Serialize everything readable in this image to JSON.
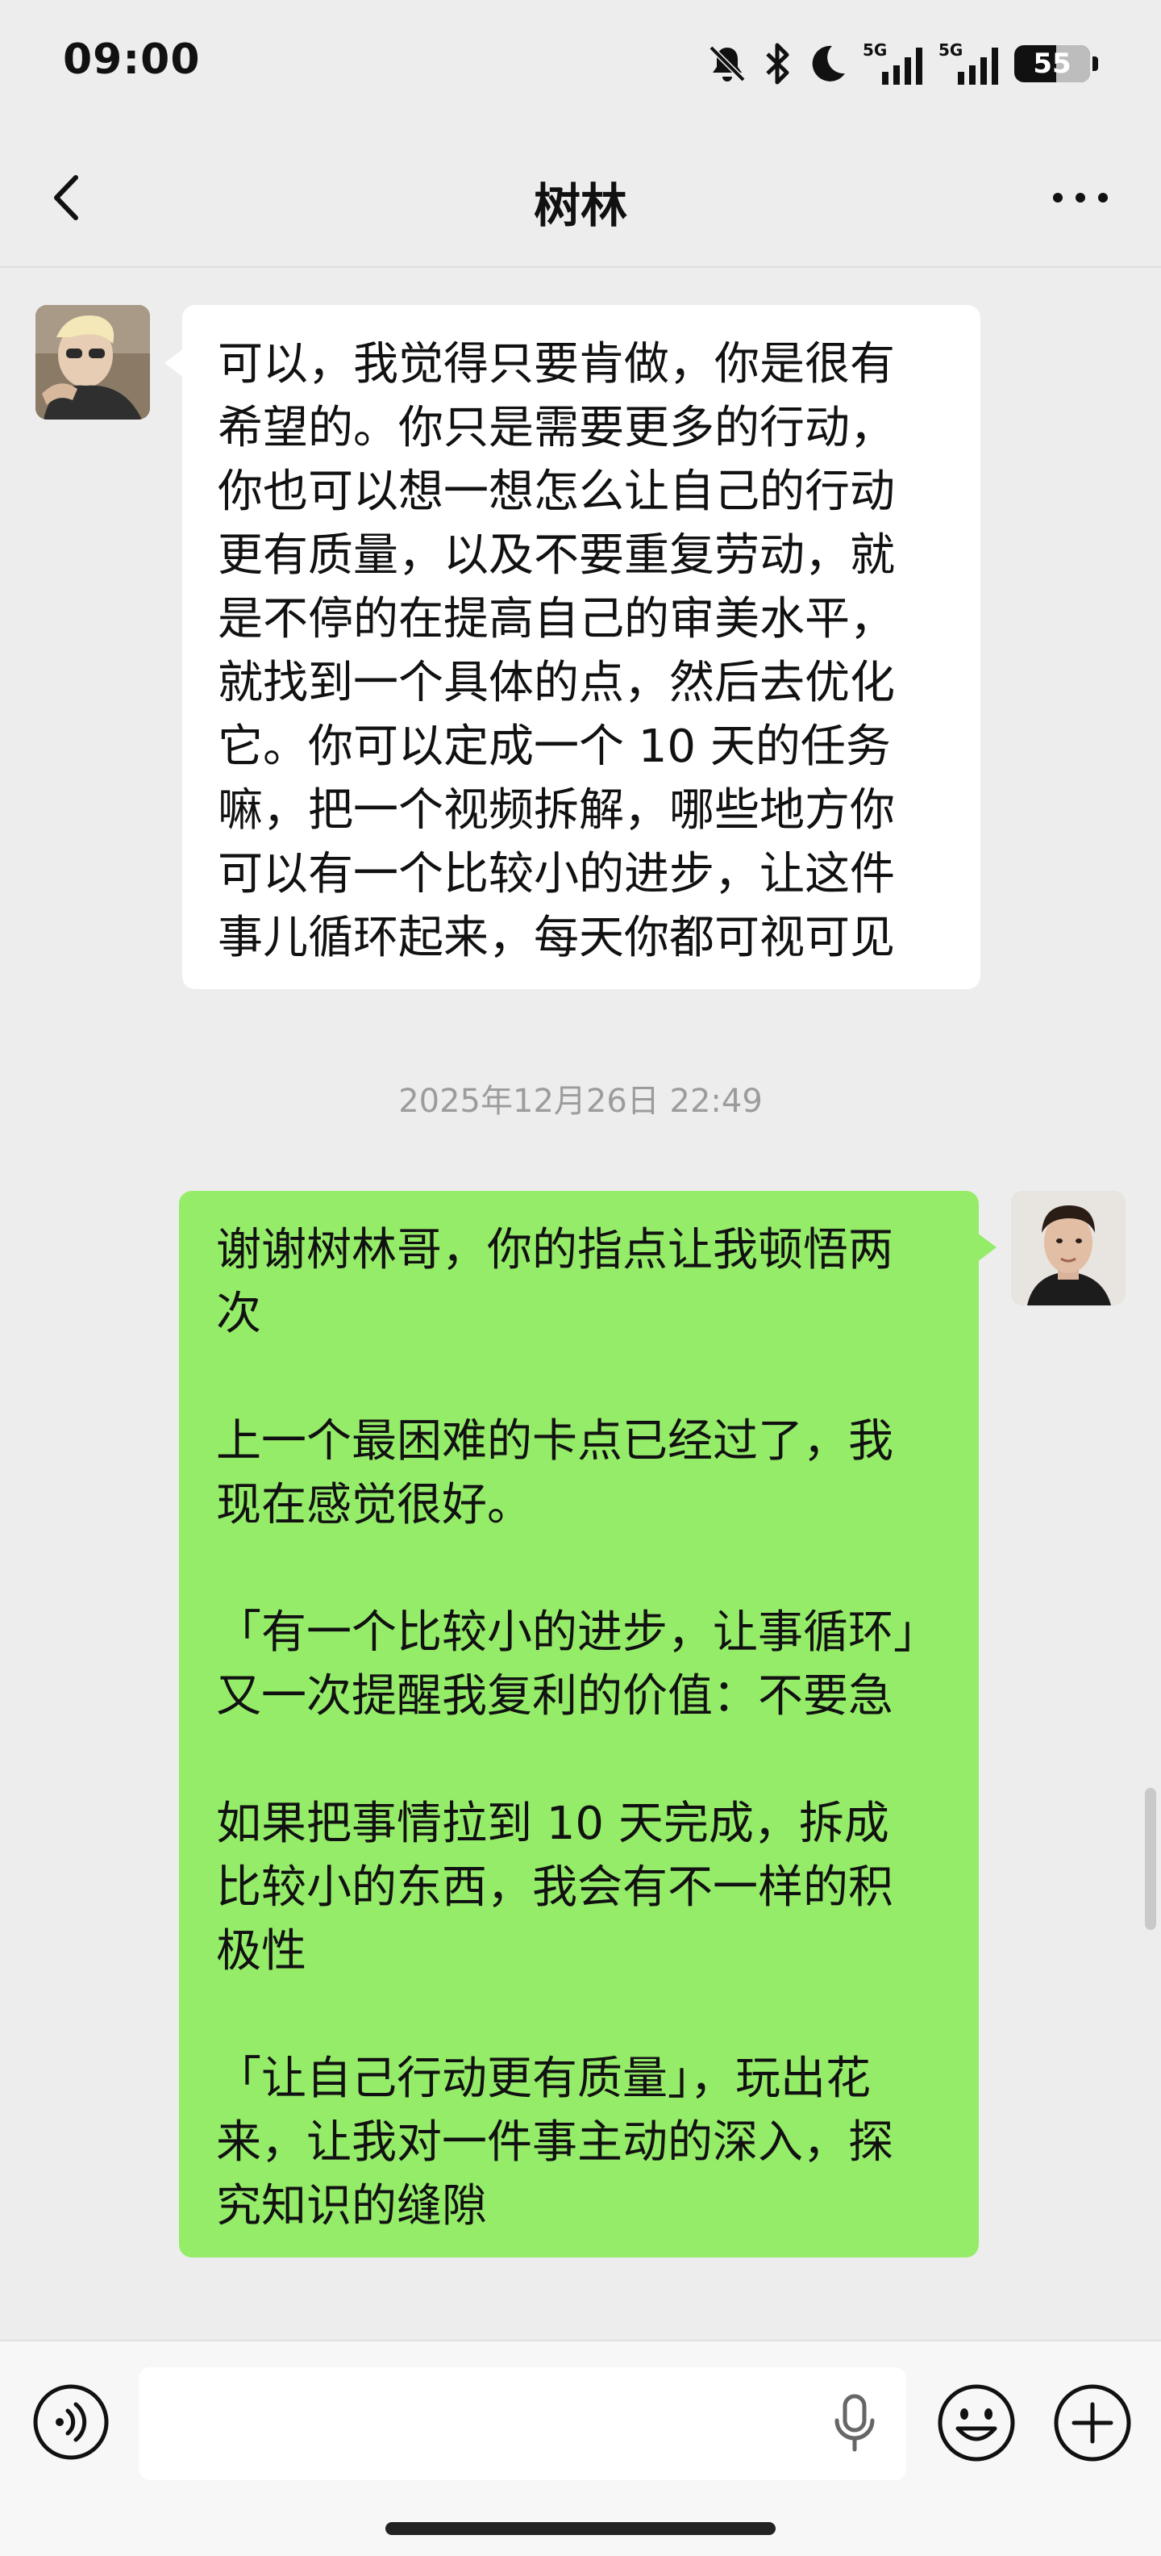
{
  "status_bar": {
    "time": "09:00",
    "signal_1_label": "5G",
    "signal_2_label": "5G",
    "battery_level": "55",
    "icons": [
      "mute-bell-icon",
      "bluetooth-icon",
      "moon-icon",
      "signal-icon",
      "signal-icon",
      "battery-icon"
    ]
  },
  "nav": {
    "title": "树林",
    "back_icon": "chevron-left-icon",
    "more_icon": "more-dots-icon"
  },
  "messages": [
    {
      "direction": "incoming",
      "text": "可以，我觉得只要肯做，你是很有\n希望的。你只是需要更多的行动，\n你也可以想一想怎么让自己的行动\n更有质量，以及不要重复劳动，就\n是不停的在提高自己的审美水平，\n就找到一个具体的点，然后去优化\n它。你可以定成一个 10 天的任务\n嘛，把一个视频拆解，哪些地方你\n可以有一个比较小的进步，让这件\n事儿循环起来，每天你都可视可见"
    },
    {
      "direction": "outgoing",
      "text": "谢谢树林哥，你的指点让我顿悟两\n次\n\n上一个最困难的卡点已经过了，我\n现在感觉很好。\n\n「有一个比较小的进步，让事循环」\n又一次提醒我复利的价值：不要急\n\n如果把事情拉到 10 天完成，拆成\n比较小的东西，我会有不一样的积\n极性\n\n「让自己行动更有质量」，玩出花\n来，让我对一件事主动的深入，探\n究知识的缝隙"
    }
  ],
  "timestamp": "2025年12月26日 22:49",
  "input_bar": {
    "placeholder": "",
    "value": "",
    "icons": [
      "voice-icon",
      "mic-icon",
      "emoji-icon",
      "plus-icon"
    ]
  },
  "colors": {
    "background": "#ededed",
    "incoming_bubble": "#ffffff",
    "outgoing_bubble": "#95ec69",
    "timestamp": "#9c9c9c"
  }
}
